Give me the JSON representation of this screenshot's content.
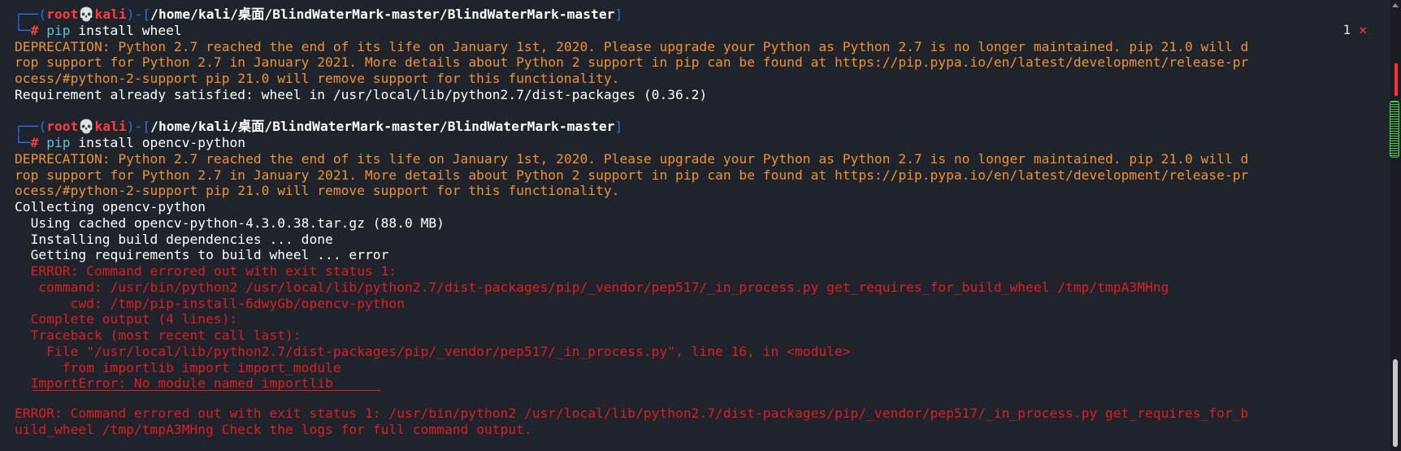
{
  "prompt": {
    "user": "root",
    "host": "kali",
    "path": "/home/kali/桌面/BlindWaterMark-master/BlindWaterMark-master"
  },
  "status": {
    "exit_code": "1",
    "error_mark": "✕"
  },
  "blocks": [
    {
      "command": {
        "program": "pip",
        "args": "install wheel"
      },
      "deprecation": [
        "DEPRECATION: Python 2.7 reached the end of its life on January 1st, 2020. Please upgrade your Python as Python 2.7 is no longer maintained. pip 21.0 will d",
        "rop support for Python 2.7 in January 2021. More details about Python 2 support in pip can be found at https://pip.pypa.io/en/latest/development/release-pr",
        "ocess/#python-2-support pip 21.0 will remove support for this functionality."
      ],
      "output": [
        "Requirement already satisfied: wheel in /usr/local/lib/python2.7/dist-packages (0.36.2)"
      ]
    },
    {
      "command": {
        "program": "pip",
        "args": "install opencv-python"
      },
      "deprecation": [
        "DEPRECATION: Python 2.7 reached the end of its life on January 1st, 2020. Please upgrade your Python as Python 2.7 is no longer maintained. pip 21.0 will d",
        "rop support for Python 2.7 in January 2021. More details about Python 2 support in pip can be found at https://pip.pypa.io/en/latest/development/release-pr",
        "ocess/#python-2-support pip 21.0 will remove support for this functionality."
      ],
      "output": [
        "Collecting opencv-python",
        "  Using cached opencv-python-4.3.0.38.tar.gz (88.0 MB)",
        "  Installing build dependencies ... done",
        "  Getting requirements to build wheel ... error"
      ],
      "errors": [
        "  ERROR: Command errored out with exit status 1:",
        "   command: /usr/bin/python2 /usr/local/lib/python2.7/dist-packages/pip/_vendor/pep517/_in_process.py get_requires_for_build_wheel /tmp/tmpA3MHng",
        "       cwd: /tmp/pip-install-6dwyGb/opencv-python",
        "  Complete output (4 lines):",
        "  Traceback (most recent call last):",
        "    File \"/usr/local/lib/python2.7/dist-packages/pip/_vendor/pep517/_in_process.py\", line 16, in <module>",
        "      from importlib import import_module",
        "  ImportError: No module named importlib"
      ],
      "final_error": [
        "ERROR: Command errored out with exit status 1: /usr/bin/python2 /usr/local/lib/python2.7/dist-packages/pip/_vendor/pep517/_in_process.py get_requires_for_b",
        "uild_wheel /tmp/tmpA3MHng Check the logs for full command output."
      ]
    }
  ]
}
